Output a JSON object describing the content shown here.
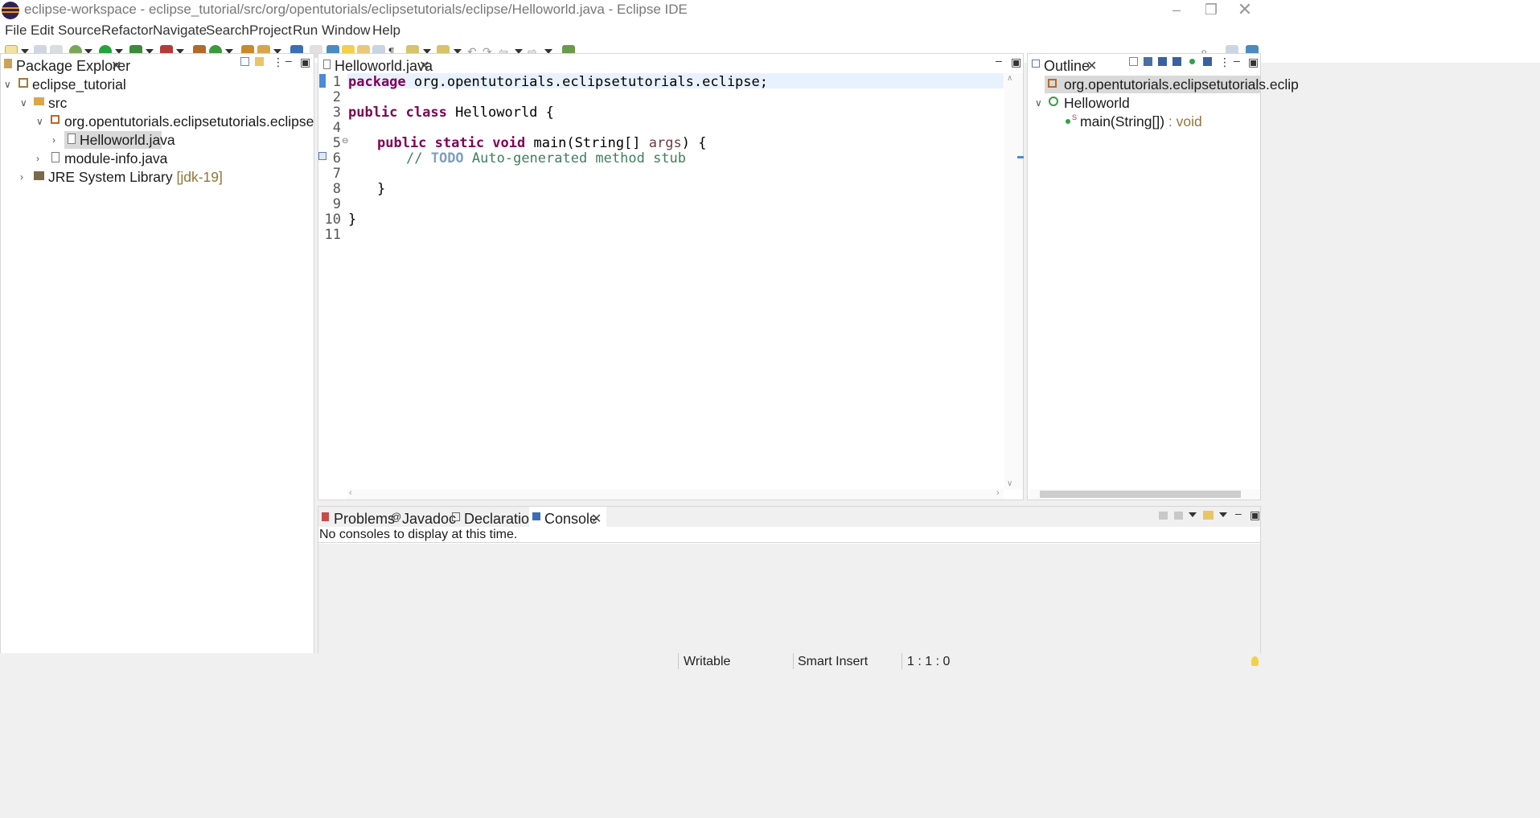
{
  "window": {
    "title": "eclipse-workspace - eclipse_tutorial/src/org/opentutorials/eclipsetutorials/eclipse/Helloworld.java - Eclipse IDE",
    "minimize_icon": "minimize-icon",
    "restore_icon": "restore-icon",
    "close_icon": "close-icon"
  },
  "menu": [
    "File",
    "Edit",
    "Source",
    "Refactor",
    "Navigate",
    "Search",
    "Project",
    "Run",
    "Window",
    "Help"
  ],
  "package_explorer": {
    "tab_label": "Package Explorer",
    "tree": [
      {
        "label": "eclipse_tutorial",
        "icon": "project-icon"
      },
      {
        "label": "src",
        "icon": "source-folder-icon"
      },
      {
        "label": "org.opentutorials.eclipsetutorials.eclipse",
        "icon": "package-icon"
      },
      {
        "label": "Helloworld.java",
        "icon": "java-file-icon",
        "selected": true
      },
      {
        "label": "module-info.java",
        "icon": "java-file-icon"
      },
      {
        "label": "JRE System Library",
        "suffix": "[jdk-19]",
        "icon": "library-icon"
      }
    ]
  },
  "editor": {
    "tab_label": "Helloworld.java",
    "line_numbers": [
      "1",
      "2",
      "3",
      "4",
      "5",
      "6",
      "7",
      "8",
      "9",
      "10",
      "11"
    ],
    "code": {
      "l1_kw": "package",
      "l1_rest": " org.opentutorials.eclipsetutorials.eclipse;",
      "l3_kw": "public class",
      "l3_rest": " Helloworld {",
      "l5_kw": "public static void",
      "l5_mid": " main(String[] ",
      "l5_param": "args",
      "l5_end": ") {",
      "l6_cm1": "// ",
      "l6_todo": "TODO",
      "l6_cm2": " Auto-generated method stub",
      "l8": "}",
      "l10": "}"
    }
  },
  "outline": {
    "tab_label": "Outline",
    "items": [
      {
        "label": "org.opentutorials.eclipsetutorials.eclip",
        "icon": "package-icon"
      },
      {
        "label": "Helloworld",
        "icon": "class-icon"
      },
      {
        "label": "main(String[])",
        "type": " : void",
        "icon": "method-icon"
      }
    ]
  },
  "bottom": {
    "tabs": [
      "Problems",
      "Javadoc",
      "Declaration",
      "Console"
    ],
    "active_tab": "Console",
    "console_message": "No consoles to display at this time."
  },
  "status": {
    "writable": "Writable",
    "insert_mode": "Smart Insert",
    "position": "1 : 1 : 0"
  },
  "colors": {
    "keyword": "#7f0055",
    "comment": "#3f7f5f",
    "todo": "#7f9fbf",
    "selection": "#d9d9d9",
    "current_line": "#e8f2fe"
  }
}
